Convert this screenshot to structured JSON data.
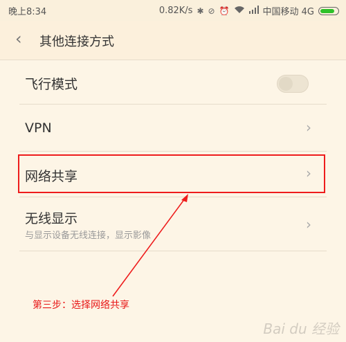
{
  "status_bar": {
    "time": "晚上8:34",
    "net_speed": "0.82K/s",
    "carrier": "中国移动 4G",
    "battery_level": 0.85,
    "battery_color": "#2ec12a",
    "icons": [
      "bluetooth-icon",
      "mute-icon",
      "alarm-icon",
      "wifi-icon",
      "signal-icon"
    ]
  },
  "header": {
    "title": "其他连接方式",
    "back_icon": "chevron-left-icon"
  },
  "settings": {
    "airplane": {
      "label": "飞行模式",
      "toggle_on": false
    },
    "vpn": {
      "label": "VPN"
    },
    "tethering": {
      "label": "网络共享"
    },
    "wireless_display": {
      "label": "无线显示",
      "subtitle": "与显示设备无线连接，显示影像"
    }
  },
  "annotation": {
    "text": "第三步：选择网络共享",
    "color": "#e81818"
  },
  "watermark": {
    "text": "Bai du 经验"
  }
}
